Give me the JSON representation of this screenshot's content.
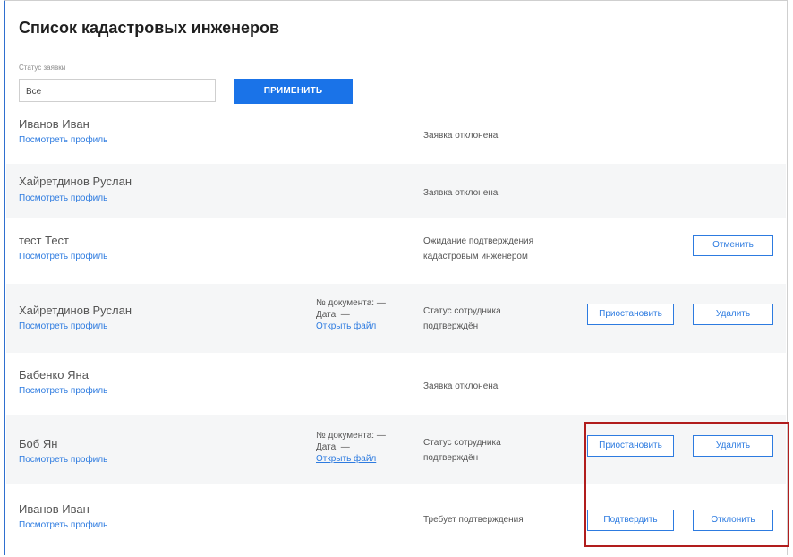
{
  "page": {
    "title": "Список кадастровых инженеров",
    "filter_label": "Статус заявки",
    "filter_value": "Все",
    "apply_label": "ПРИМЕНИТЬ"
  },
  "rows": [
    {
      "name": "Иванов Иван",
      "profile": "Посмотреть профиль",
      "status": "Заявка отклонена"
    },
    {
      "name": "Хайретдинов Руслан",
      "profile": "Посмотреть профиль",
      "status": "Заявка отклонена"
    },
    {
      "name": "тест Тест",
      "profile": "Посмотреть профиль",
      "status_l1": "Ожидание подтверждения",
      "status_l2": "кадастровым инженером",
      "btn1": "Отменить"
    },
    {
      "name": "Хайретдинов Руслан",
      "profile": "Посмотреть профиль",
      "doc_num": "№ документа:  —",
      "doc_date": "Дата: —",
      "doc_link": "Открыть файл",
      "status_l1": "Статус сотрудника",
      "status_l2": "подтверждён",
      "btn1": "Приостановить",
      "btn2": "Удалить"
    },
    {
      "name": "Бабенко Яна",
      "profile": "Посмотреть профиль",
      "status": "Заявка отклонена"
    },
    {
      "name": "Боб Ян",
      "profile": "Посмотреть профиль",
      "doc_num": "№ документа:  —",
      "doc_date": "Дата: —",
      "doc_link": "Открыть файл",
      "status_l1": "Статус сотрудника",
      "status_l2": "подтверждён",
      "btn1": "Приостановить",
      "btn2": "Удалить"
    },
    {
      "name": "Иванов Иван",
      "profile": "Посмотреть профиль",
      "status": "Требует подтверждения",
      "btn1": "Подтвердить",
      "btn2": "Отклонить"
    }
  ]
}
